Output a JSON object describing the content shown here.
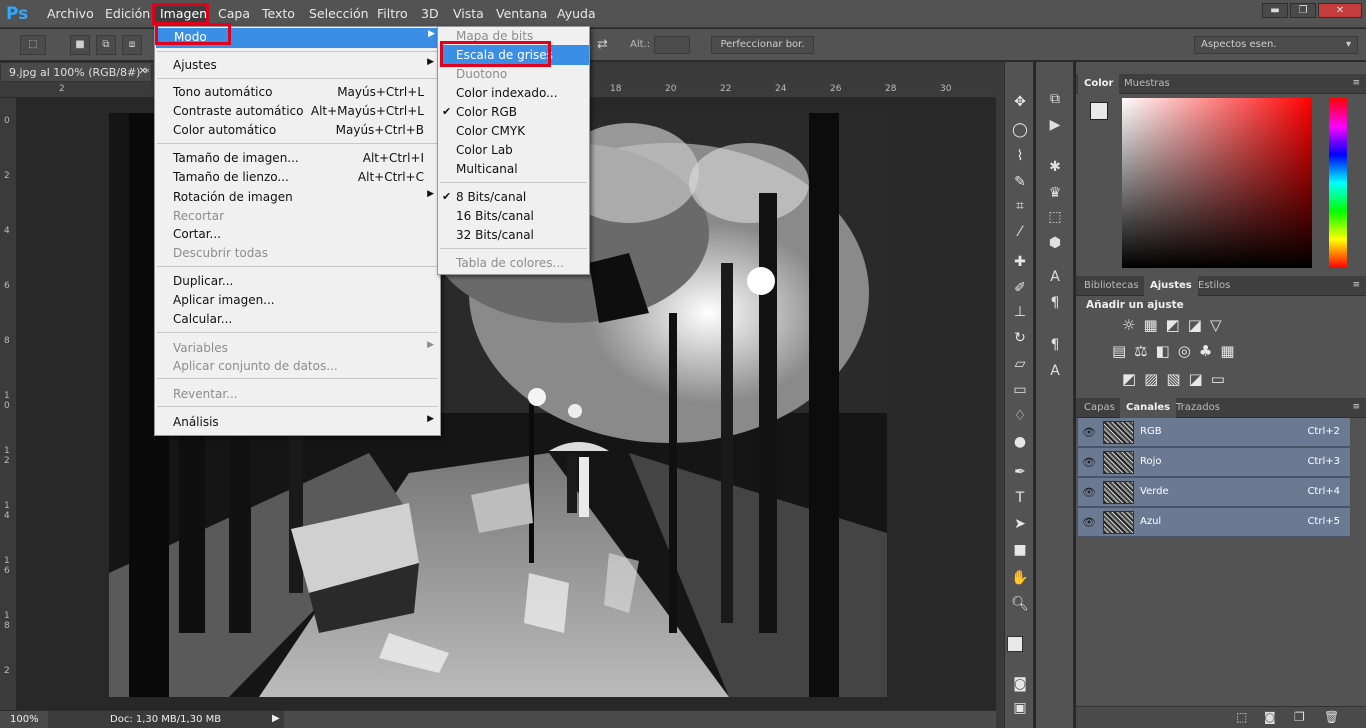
{
  "app": {
    "logo": "Ps"
  },
  "menubar": {
    "items": [
      "Archivo",
      "Edición",
      "Imagen",
      "Capa",
      "Texto",
      "Selección",
      "Filtro",
      "3D",
      "Vista",
      "Ventana",
      "Ayuda"
    ]
  },
  "window_controls": {
    "minimize": "▬",
    "restore": "❐",
    "close": "✕"
  },
  "options_bar": {
    "alt_label": "Alt.:",
    "refine_button": "Perfeccionar bor.",
    "workspace": "Aspectos esen."
  },
  "document": {
    "tab_title": "9.jpg al 100% (RGB/8#) *",
    "ruler_top": [
      "2",
      "18",
      "20",
      "22",
      "24",
      "26",
      "28",
      "30"
    ],
    "ruler_left": [
      "0",
      "2",
      "4",
      "6",
      "8",
      "1 0",
      "1 2",
      "1 4",
      "1 6",
      "1 8",
      "2"
    ]
  },
  "status": {
    "zoom": "100%",
    "doc": "Doc: 1,30 MB/1,30 MB"
  },
  "imagen_menu": {
    "modo": "Modo",
    "ajustes": "Ajustes",
    "tono": {
      "label": "Tono automático",
      "shortcut": "Mayús+Ctrl+L"
    },
    "contraste": {
      "label": "Contraste automático",
      "shortcut": "Alt+Mayús+Ctrl+L"
    },
    "color_auto": {
      "label": "Color automático",
      "shortcut": "Mayús+Ctrl+B"
    },
    "tamano_imagen": {
      "label": "Tamaño de imagen...",
      "shortcut": "Alt+Ctrl+I"
    },
    "tamano_lienzo": {
      "label": "Tamaño de lienzo...",
      "shortcut": "Alt+Ctrl+C"
    },
    "rotacion": "Rotación de imagen",
    "recortar": "Recortar",
    "cortar": "Cortar...",
    "descubrir": "Descubrir todas",
    "duplicar": "Duplicar...",
    "aplicar_imagen": "Aplicar imagen...",
    "calcular": "Calcular...",
    "variables": "Variables",
    "aplicar_conjunto": "Aplicar conjunto de datos...",
    "reventar": "Reventar...",
    "analisis": "Análisis"
  },
  "modo_menu": {
    "mapa_bits": "Mapa de bits",
    "escala_grises": "Escala de grises",
    "duotono": "Duotono",
    "color_indexado": "Color indexado...",
    "color_rgb": "Color RGB",
    "color_cmyk": "Color CMYK",
    "color_lab": "Color Lab",
    "multicanal": "Multicanal",
    "bits8": "8 Bits/canal",
    "bits16": "16 Bits/canal",
    "bits32": "32 Bits/canal",
    "tabla_colores": "Tabla de colores...",
    "check": "✔"
  },
  "color_panel": {
    "tabs": [
      "Color",
      "Muestras"
    ]
  },
  "adjust_panel": {
    "tabs": [
      "Bibliotecas",
      "Ajustes",
      "Estilos"
    ],
    "heading": "Añadir un ajuste"
  },
  "channels_panel": {
    "tabs": [
      "Capas",
      "Canales",
      "Trazados"
    ],
    "channels": [
      {
        "name": "RGB",
        "shortcut": "Ctrl+2"
      },
      {
        "name": "Rojo",
        "shortcut": "Ctrl+3"
      },
      {
        "name": "Verde",
        "shortcut": "Ctrl+4"
      },
      {
        "name": "Azul",
        "shortcut": "Ctrl+5"
      }
    ]
  },
  "colors": {
    "menu_highlight": "#3a8ee6",
    "annotation_red": "#e3001b",
    "ps_blue": "#31a8ff"
  }
}
